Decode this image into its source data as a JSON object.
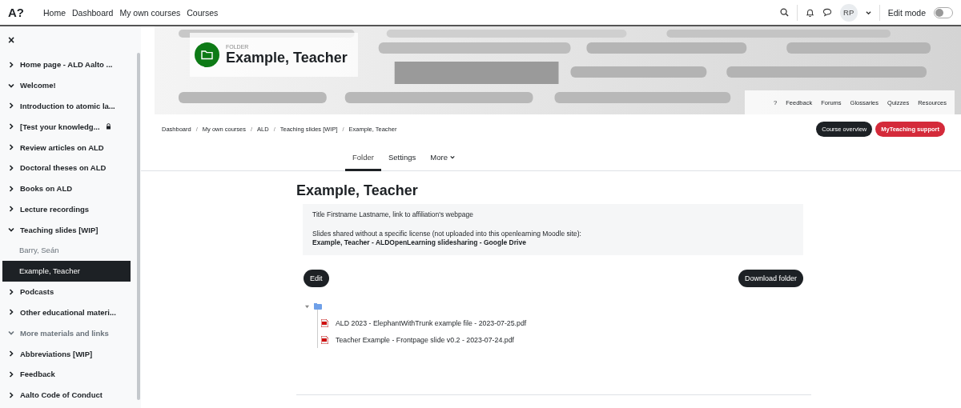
{
  "topnav": {
    "logo": "A?",
    "links": [
      "Home",
      "Dashboard",
      "My own courses",
      "Courses"
    ],
    "avatar": "RP",
    "edit_mode": {
      "label": "Edit mode",
      "on": false
    }
  },
  "sidebar": {
    "close": "×",
    "items": [
      {
        "label": "Home page - ALD Aalto ...",
        "expanded": false,
        "dimmed": false,
        "locked": false
      },
      {
        "label": "Welcome!",
        "expanded": true,
        "dimmed": false,
        "locked": false
      },
      {
        "label": "Introduction to atomic la...",
        "expanded": false,
        "dimmed": false,
        "locked": false
      },
      {
        "label": "[Test your knowledg...",
        "expanded": false,
        "dimmed": false,
        "locked": true
      },
      {
        "label": "Review articles on ALD",
        "expanded": false,
        "dimmed": false,
        "locked": false
      },
      {
        "label": "Doctoral theses on ALD",
        "expanded": false,
        "dimmed": false,
        "locked": false
      },
      {
        "label": "Books on ALD",
        "expanded": false,
        "dimmed": false,
        "locked": false
      },
      {
        "label": "Lecture recordings",
        "expanded": false,
        "dimmed": false,
        "locked": false
      },
      {
        "label": "Teaching slides [WIP]",
        "expanded": true,
        "dimmed": false,
        "locked": false,
        "children": [
          {
            "label": "Barry, Seán",
            "selected": false
          },
          {
            "label": "Example, Teacher",
            "selected": true
          }
        ]
      },
      {
        "label": "Podcasts",
        "expanded": false,
        "dimmed": false,
        "locked": false
      },
      {
        "label": "Other educational materi...",
        "expanded": false,
        "dimmed": false,
        "locked": false
      },
      {
        "label": "More materials and links",
        "expanded": true,
        "dimmed": true,
        "locked": false
      },
      {
        "label": "Abbreviations [WIP]",
        "expanded": false,
        "dimmed": false,
        "locked": false
      },
      {
        "label": "Feedback",
        "expanded": false,
        "dimmed": false,
        "locked": false
      },
      {
        "label": "Aalto Code of Conduct",
        "expanded": false,
        "dimmed": false,
        "locked": false
      }
    ]
  },
  "header": {
    "activity": {
      "type_label": "FOLDER",
      "title": "Example, Teacher"
    },
    "secondary_links": [
      "?",
      "Feedback",
      "Forums",
      "Glossaries",
      "Quizzes",
      "Resources"
    ]
  },
  "breadcrumb": [
    {
      "label": "Dashboard"
    },
    {
      "separator": "/",
      "label": "My own courses"
    },
    {
      "separator": "/",
      "label": "ALD"
    },
    {
      "separator": "/",
      "label": "Teaching slides [WIP]"
    },
    {
      "separator": "/",
      "label": "Example, Teacher"
    }
  ],
  "header_buttons": [
    {
      "label": "Course overview",
      "kind": "dark"
    },
    {
      "label": "MyTeaching support",
      "kind": "red"
    }
  ],
  "tabs": [
    {
      "label": "Folder",
      "selected": true,
      "kind": "plain"
    },
    {
      "label": "Settings",
      "selected": false,
      "kind": "plain"
    },
    {
      "label": "More",
      "selected": false,
      "kind": "menu"
    }
  ],
  "page": {
    "heading": "Example, Teacher",
    "intro": [
      "Title Firstname Lastname, link to affiliation's webpage",
      "Slides shared without a specific license (not uploaded into this openlearning Moodle site):"
    ],
    "link": "Example, Teacher - ALDOpenLearning slidesharing - Google Drive",
    "buttons": [
      {
        "label": "Edit"
      },
      {
        "label": "Download folder"
      }
    ],
    "tree": {
      "expanded": true,
      "files": [
        "ALD 2023 - ElephantWithTrunk example file - 2023-07-25.pdf",
        "Teacher Example - Frontpage slide v0.2 - 2023-07-24.pdf"
      ]
    }
  }
}
